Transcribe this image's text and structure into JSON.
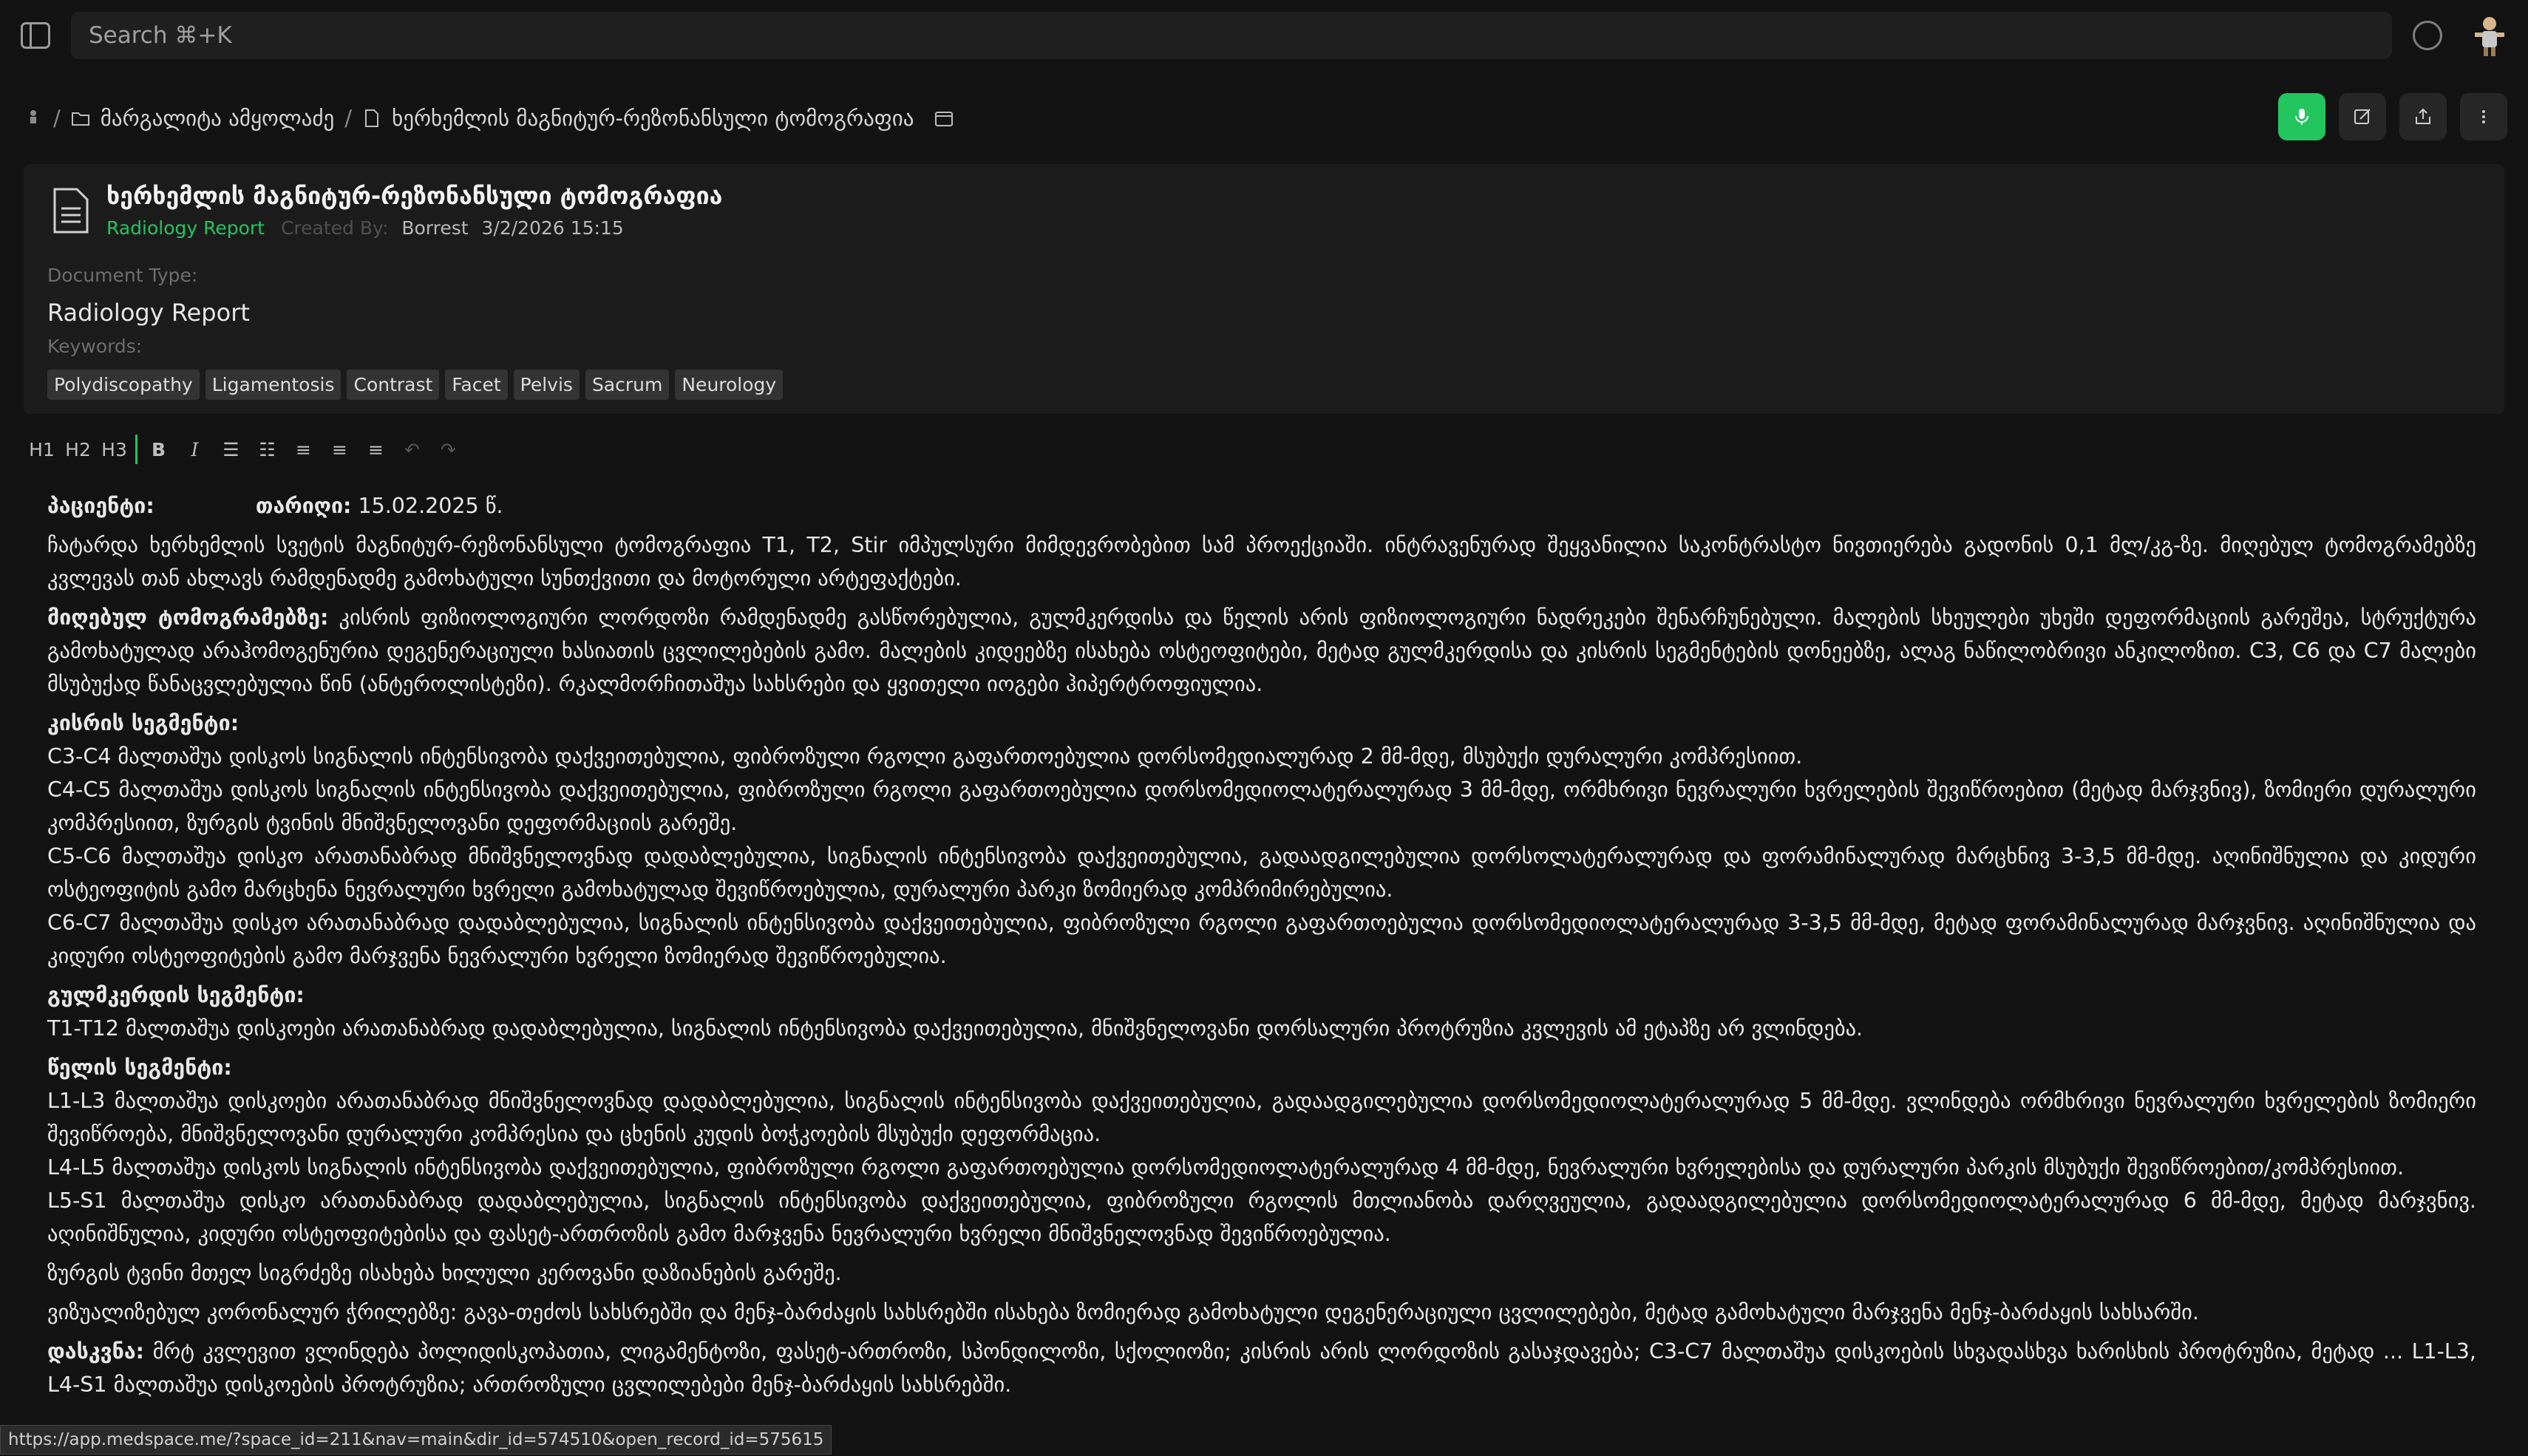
{
  "search": {
    "placeholder": "Search ⌘+K"
  },
  "breadcrumb": {
    "folder": "მარგალიტა ამყოლაძე",
    "document": "ხერხემლის მაგნიტურ-რეზონანსული ტომოგრაფია"
  },
  "document": {
    "title": "ხერხემლის მაგნიტურ-რეზონანსული ტომოგრაფია",
    "type_badge": "Radiology Report",
    "created_by_label": "Created By:",
    "created_by": "Borrest",
    "created_at": "3/2/2026 15:15",
    "doctype_label": "Document Type:",
    "doctype_value": "Radiology Report",
    "keywords_label": "Keywords:",
    "keywords": [
      "Polydiscopathy",
      "Ligamentosis",
      "Contrast",
      "Facet",
      "Pelvis",
      "Sacrum",
      "Neurology"
    ]
  },
  "editor_toolbar": {
    "h1": "H1",
    "h2": "H2",
    "h3": "H3",
    "bold": "B",
    "italic": "I",
    "bullet_list": "☰",
    "ordered_list": "☷",
    "align_left": "≡",
    "align_center": "≡",
    "align_right": "≡",
    "undo": "↶",
    "redo": "↷"
  },
  "report": {
    "patient_label": "პაციენტი:",
    "date_label": "თარიღი:",
    "date_value": " 15.02.2025 წ.",
    "intro": "ჩატარდა ხერხემლის სვეტის მაგნიტურ-რეზონანსული ტომოგრაფია T1, T2, Stir იმპულსური მიმდევრობებით სამ პროექციაში. ინტრავენურად შეყვანილია საკონტრასტო ნივთიერება გადონის 0,1 მლ/კგ-ზე. მიღებულ ტომოგრამებზე კვლევას თან ახლავს რამდენადმე გამოხატული სუნთქვითი და მოტორული არტეფაქტები.",
    "tomo_heading": "მიღებულ ტომოგრამებზე:",
    "tomo_text": " კისრის ფიზიოლოგიური ლორდოზი რამდენადმე გასწორებულია, გულმკერდისა და წელის არის ფიზიოლოგიური ნადრეკები შენარჩუნებული. მალების სხეულები უხეში დეფორმაციის გარეშეა, სტრუქტურა გამოხატულად არაჰომოგენურია დეგენერაციული ხასიათის ცვლილებების გამო. მალების კიდეებზე ისახება ოსტეოფიტები, მეტად გულმკერდისა და კისრის სეგმენტების დონეებზე, ალაგ ნაწილობრივი ანკილოზით. C3, C6 და C7 მალები მსუბუქად წანაცვლებულია წინ (ანტეროლისტეზი). რკალმორჩითაშუა სახსრები და ყვითელი იოგები ჰიპერტროფიულია.",
    "cervical_heading": "კისრის სეგმენტი:",
    "cervical": [
      "C3-C4 მალთაშუა დისკოს სიგნალის ინტენსივობა დაქვეითებულია, ფიბროზული რგოლი გაფართოებულია დორსომედიალურად 2 მმ-მდე, მსუბუქი დურალური კომპრესიით.",
      "C4-C5 მალთაშუა დისკოს სიგნალის ინტენსივობა დაქვეითებულია, ფიბროზული რგოლი გაფართოებულია დორსომედიოლატერალურად 3 მმ-მდე, ორმხრივი ნევრალური ხვრელების შევიწროებით (მეტად მარჯვნივ), ზომიერი დურალური კომპრესიით, ზურგის ტვინის მნიშვნელოვანი დეფორმაციის გარეშე.",
      "C5-C6 მალთაშუა დისკო არათანაბრად მნიშვნელოვნად დადაბლებულია, სიგნალის ინტენსივობა დაქვეითებულია, გადაადგილებულია დორსოლატერალურად და ფორამინალურად მარცხნივ 3-3,5 მმ-მდე. აღინიშნულია და კიდური ოსტეოფიტის გამო მარცხენა ნევრალური ხვრელი გამოხატულად შევიწროებულია, დურალური პარკი ზომიერად კომპრიმირებულია.",
      "C6-C7 მალთაშუა დისკო არათანაბრად დადაბლებულია, სიგნალის ინტენსივობა დაქვეითებულია, ფიბროზული რგოლი გაფართოებულია დორსომედიოლატერალურად 3-3,5 მმ-მდე, მეტად ფორამინალურად მარჯვნივ. აღინიშნულია და კიდური ოსტეოფიტების გამო მარჯვენა ნევრალური ხვრელი ზომიერად შევიწროებულია."
    ],
    "thoracic_heading": "გულმკერდის სეგმენტი:",
    "thoracic": [
      "T1-T12 მალთაშუა დისკოები არათანაბრად დადაბლებულია, სიგნალის ინტენსივობა დაქვეითებულია, მნიშვნელოვანი დორსალური პროტრუზია კვლევის ამ ეტაპზე არ ვლინდება."
    ],
    "lumbar_heading": "წელის სეგმენტი:",
    "lumbar": [
      "L1-L3 მალთაშუა დისკოები არათანაბრად მნიშვნელოვნად დადაბლებულია, სიგნალის ინტენსივობა დაქვეითებულია, გადაადგილებულია დორსომედიოლატერალურად 5 მმ-მდე. ვლინდება ორმხრივი ნევრალური ხვრელების ზომიერი შევიწროება, მნიშვნელოვანი დურალური კომპრესია და ცხენის კუდის ბოჭკოების მსუბუქი დეფორმაცია.",
      "L4-L5 მალთაშუა დისკოს სიგნალის ინტენსივობა დაქვეითებულია, ფიბროზული რგოლი გაფართოებულია დორსომედიოლატერალურად 4 მმ-მდე, ნევრალური ხვრელებისა და დურალური პარკის მსუბუქი შევიწროებით/კომპრესიით.",
      "L5-S1 მალთაშუა დისკო არათანაბრად დადაბლებულია, სიგნალის ინტენსივობა დაქვეითებულია, ფიბროზული რგოლის მთლიანობა დარღვეულია, გადაადგილებულია დორსომედიოლატერალურად 6 მმ-მდე, მეტად მარჯვნივ. აღინიშნულია, კიდური ოსტეოფიტებისა და ფასეტ-ართროზის გამო მარჯვენა ნევრალური ხვრელი მნიშვნელოვნად შევიწროებულია."
    ],
    "spinal_cord": "ზურგის ტვინი მთელ სიგრძეზე ისახება ხილული კეროვანი დაზიანების გარეშე.",
    "sacroiliac": "ვიზუალიზებულ კორონალურ ჭრილებზე: გავა-თეძოს სახსრებში და მენჯ-ბარძაყის სახსრებში ისახება ზომიერად გამოხატული დეგენერაციული ცვლილებები, მეტად გამოხატული მარჯვენა მენჯ-ბარძაყის სახსარში.",
    "conclusion_heading": "დასკვნა:",
    "conclusion_text": " მრტ კვლევით ვლინდება პოლიდისკოპათია, ლიგამენტოზი, ფასეტ-ართროზი, სპონდილოზი, სქოლიოზი; კისრის არის ლორდოზის გასაჯდავება; C3-C7 მალთაშუა დისკოების სხვადასხვა ხარისხის პროტრუზია, მეტად ... L1-L3, L4-S1 მალთაშუა დისკოების პროტრუზია; ართროზული ცვლილებები მენჯ-ბარძაყის სახსრებში."
  },
  "status_url": "https://app.medspace.me/?space_id=211&nav=main&dir_id=574510&open_record_id=575615"
}
